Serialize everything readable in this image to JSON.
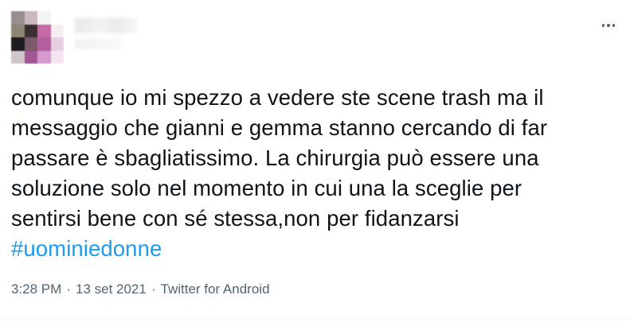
{
  "tweet": {
    "author": {
      "avatar_pixels": [
        "#9a8f8f",
        "#c9b8be",
        "#f4f4f4",
        "#ffffff",
        "#8c8474",
        "#3b2e33",
        "#c76aa3",
        "#f7eef4",
        "#1e1c20",
        "#7b5a6b",
        "#b45f9e",
        "#e7cfe1",
        "#cfc6c9",
        "#a15592",
        "#d59ad0",
        "#f3e6f0"
      ]
    },
    "more_icon": "more-horizontal-icon",
    "text_lines": [
      "comunque io mi spezzo a vedere ste scene trash ma il",
      "messaggio che gianni e gemma stanno cercando di far",
      "passare è sbagliatissimo. La chirurgia può essere una",
      "soluzione solo nel momento in cui una la sceglie per",
      "sentirsi bene con sé stessa,non per fidanzarsi"
    ],
    "hashtag": "#uominiedonne",
    "time": "3:28 PM",
    "separator": "·",
    "date": "13 set 2021",
    "source": "Twitter for Android",
    "colors": {
      "text": "#0f1419",
      "link": "#1d9bf0",
      "secondary": "#536471"
    }
  }
}
